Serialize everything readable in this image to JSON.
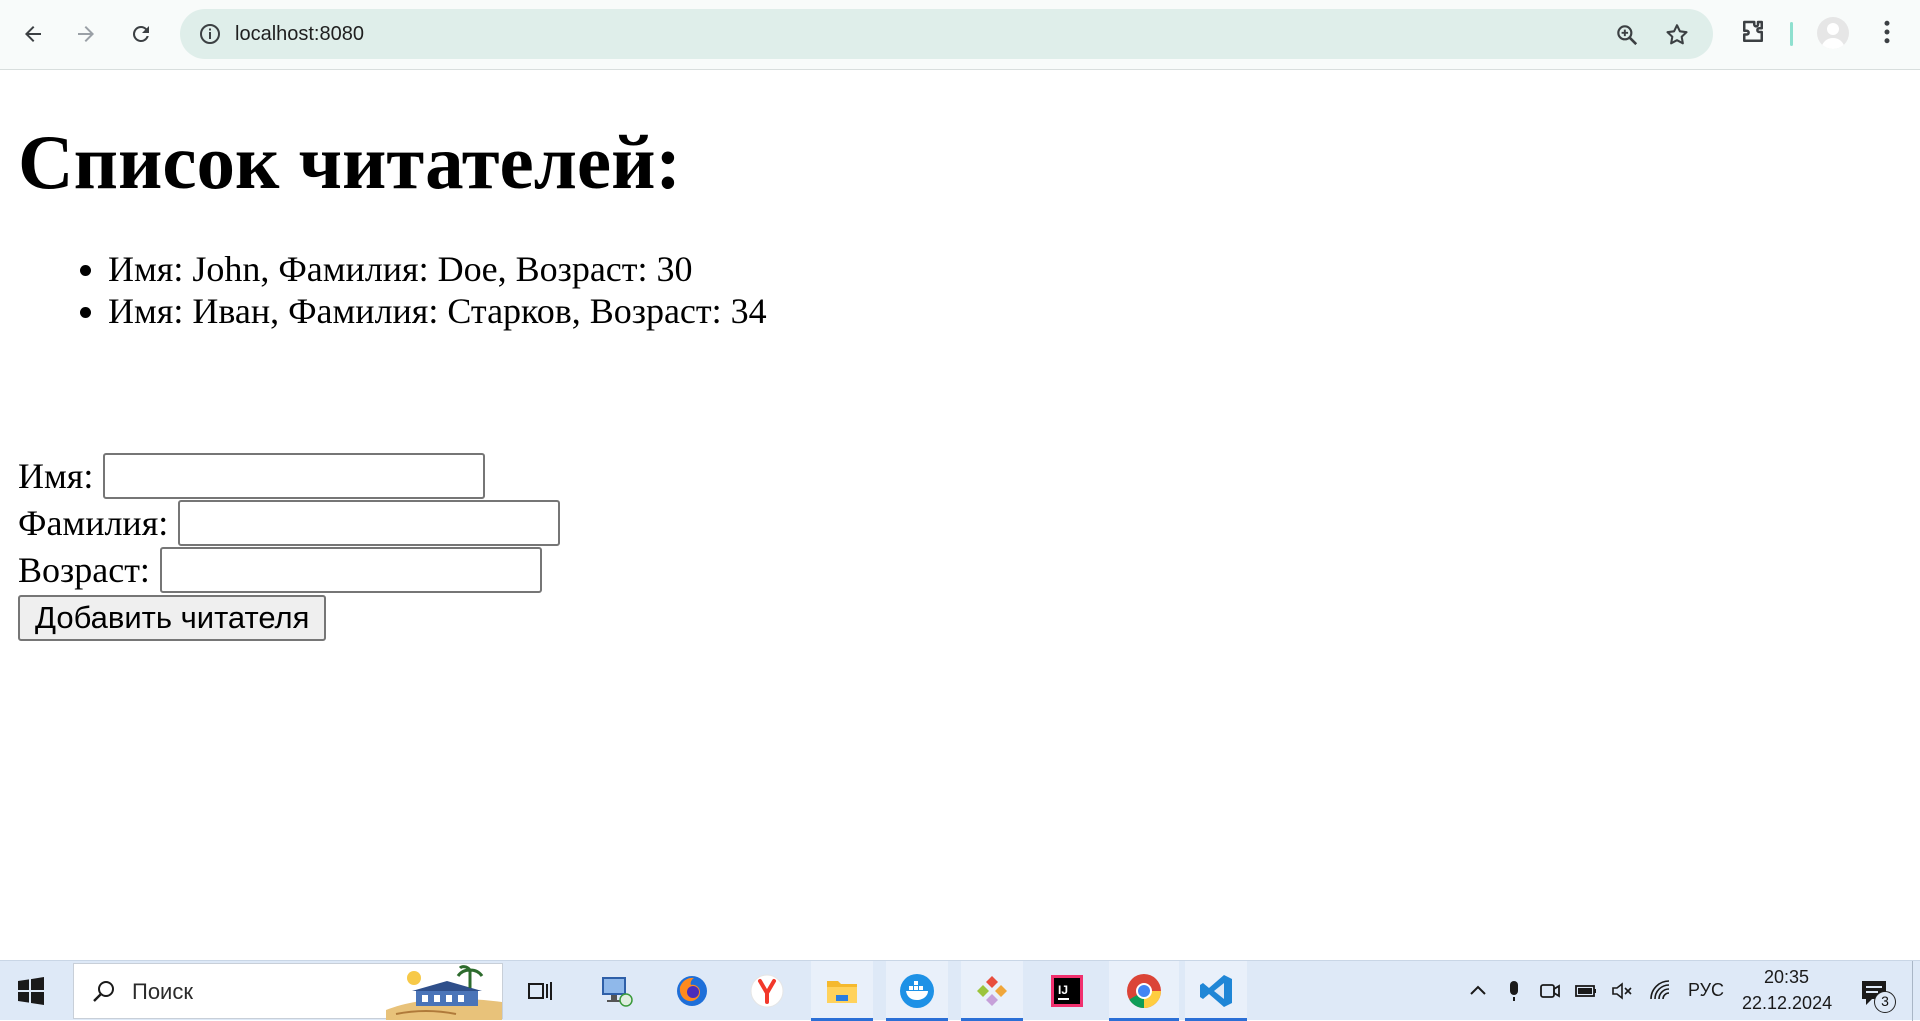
{
  "browser": {
    "url": "localhost:8080"
  },
  "page": {
    "title": "Список читателей:",
    "readers": [
      "Имя: John, Фамилия: Doe, Возраст: 30",
      "Имя: Иван, Фамилия: Старков, Возраст: 34"
    ],
    "form": {
      "first_name_label": "Имя:",
      "first_name_value": "",
      "last_name_label": "Фамилия:",
      "last_name_value": "",
      "age_label": "Возраст:",
      "age_value": "",
      "submit_label": "Добавить читателя"
    }
  },
  "taskbar": {
    "search_placeholder": "Поиск",
    "language": "РУС",
    "time": "20:35",
    "date": "22.12.2024",
    "notification_count": "3",
    "apps": [
      "task-view",
      "remote-desktop",
      "firefox",
      "yandex-browser",
      "file-explorer",
      "docker",
      "git-gui",
      "intellij-idea",
      "chrome",
      "vscode"
    ]
  },
  "colors": {
    "omnibox_bg": "#dfeeea",
    "taskbar_bg": "#dee9f7",
    "accent": "#2b6fd6"
  }
}
